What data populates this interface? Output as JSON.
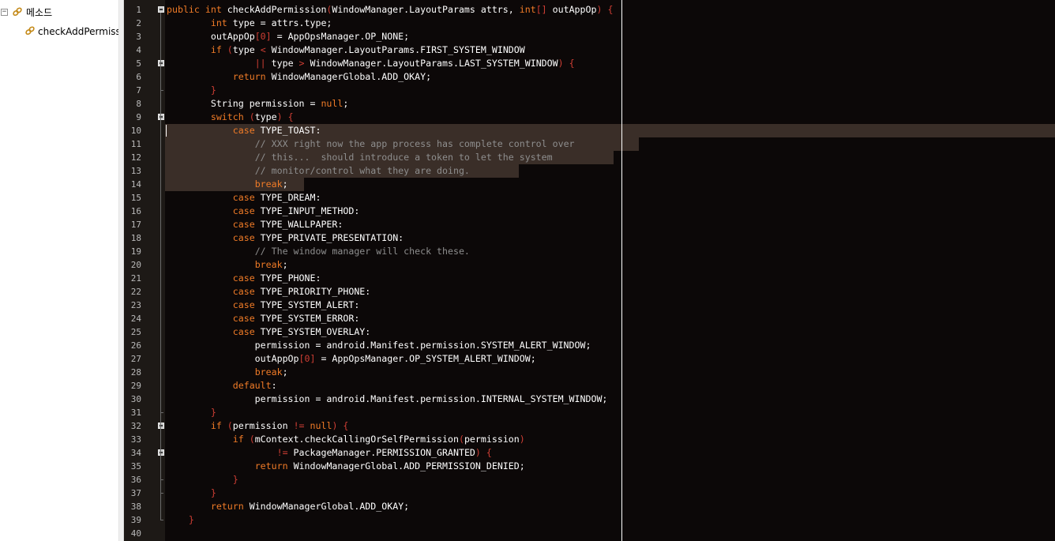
{
  "tree": {
    "root_label": "메소드",
    "root_toggle": "−",
    "child_label": "checkAddPermissic"
  },
  "editor": {
    "caret_line": 10,
    "selection_lines": [
      10,
      11,
      12,
      13,
      14
    ],
    "colors": {
      "background": "#0c0808",
      "keyword": "#f07b27",
      "comment": "#8e8e8e",
      "punctuation": "#cf3e34",
      "text": "#ffffff",
      "selection": "#3a2e28"
    },
    "lines": [
      {
        "n": "1",
        "t": [
          [
            "k",
            "public int "
          ],
          [
            "pl",
            "checkAddPermission"
          ],
          [
            "pn",
            "("
          ],
          [
            "pl",
            "WindowManager.LayoutParams attrs, "
          ],
          [
            "k",
            "int"
          ],
          [
            "pn",
            "[] "
          ],
          [
            "pl",
            "outAppOp"
          ],
          [
            "pn",
            ") {"
          ]
        ]
      },
      {
        "n": "2",
        "t": [
          [
            "pl",
            "        "
          ],
          [
            "k",
            "int "
          ],
          [
            "pl",
            "type = attrs.type;"
          ]
        ]
      },
      {
        "n": "3",
        "t": [
          [
            "pl",
            "        outAppOp"
          ],
          [
            "pn",
            "[0]"
          ],
          [
            "pl",
            " = AppOpsManager.OP_NONE;"
          ]
        ]
      },
      {
        "n": "4",
        "t": [
          [
            "pl",
            "        "
          ],
          [
            "k",
            "if "
          ],
          [
            "pn",
            "("
          ],
          [
            "pl",
            "type "
          ],
          [
            "pn",
            "<"
          ],
          [
            "pl",
            " WindowManager.LayoutParams.FIRST_SYSTEM_WINDOW"
          ]
        ]
      },
      {
        "n": "5",
        "t": [
          [
            "pl",
            "                "
          ],
          [
            "pn",
            "||"
          ],
          [
            "pl",
            " type "
          ],
          [
            "pn",
            ">"
          ],
          [
            "pl",
            " WindowManager.LayoutParams.LAST_SYSTEM_WINDOW"
          ],
          [
            "pn",
            ") {"
          ]
        ]
      },
      {
        "n": "6",
        "t": [
          [
            "pl",
            "            "
          ],
          [
            "k",
            "return "
          ],
          [
            "pl",
            "WindowManagerGlobal.ADD_OKAY;"
          ]
        ]
      },
      {
        "n": "7",
        "t": [
          [
            "pl",
            "        "
          ],
          [
            "pn",
            "}"
          ]
        ]
      },
      {
        "n": "8",
        "t": [
          [
            "pl",
            "        String permission = "
          ],
          [
            "k",
            "null"
          ],
          [
            "pl",
            ";"
          ]
        ]
      },
      {
        "n": "9",
        "t": [
          [
            "pl",
            "        "
          ],
          [
            "k",
            "switch "
          ],
          [
            "pn",
            "("
          ],
          [
            "pl",
            "type"
          ],
          [
            "pn",
            ") {"
          ]
        ]
      },
      {
        "n": "10",
        "t": [
          [
            "pl",
            "            "
          ],
          [
            "k",
            "case "
          ],
          [
            "pl",
            "TYPE_TOAST:"
          ]
        ]
      },
      {
        "n": "11",
        "t": [
          [
            "pl",
            "                "
          ],
          [
            "cm",
            "// XXX right now the app process has complete control over"
          ]
        ]
      },
      {
        "n": "12",
        "t": [
          [
            "pl",
            "                "
          ],
          [
            "cm",
            "// this...  should introduce a token to let the system"
          ]
        ]
      },
      {
        "n": "13",
        "t": [
          [
            "pl",
            "                "
          ],
          [
            "cm",
            "// monitor/control what they are doing."
          ]
        ]
      },
      {
        "n": "14",
        "t": [
          [
            "pl",
            "                "
          ],
          [
            "k",
            "break"
          ],
          [
            "pl",
            ";"
          ]
        ]
      },
      {
        "n": "15",
        "t": [
          [
            "pl",
            "            "
          ],
          [
            "k",
            "case "
          ],
          [
            "pl",
            "TYPE_DREAM:"
          ]
        ]
      },
      {
        "n": "16",
        "t": [
          [
            "pl",
            "            "
          ],
          [
            "k",
            "case "
          ],
          [
            "pl",
            "TYPE_INPUT_METHOD:"
          ]
        ]
      },
      {
        "n": "17",
        "t": [
          [
            "pl",
            "            "
          ],
          [
            "k",
            "case "
          ],
          [
            "pl",
            "TYPE_WALLPAPER:"
          ]
        ]
      },
      {
        "n": "18",
        "t": [
          [
            "pl",
            "            "
          ],
          [
            "k",
            "case "
          ],
          [
            "pl",
            "TYPE_PRIVATE_PRESENTATION:"
          ]
        ]
      },
      {
        "n": "19",
        "t": [
          [
            "pl",
            "                "
          ],
          [
            "cm",
            "// The window manager will check these."
          ]
        ]
      },
      {
        "n": "20",
        "t": [
          [
            "pl",
            "                "
          ],
          [
            "k",
            "break"
          ],
          [
            "pl",
            ";"
          ]
        ]
      },
      {
        "n": "21",
        "t": [
          [
            "pl",
            "            "
          ],
          [
            "k",
            "case "
          ],
          [
            "pl",
            "TYPE_PHONE:"
          ]
        ]
      },
      {
        "n": "22",
        "t": [
          [
            "pl",
            "            "
          ],
          [
            "k",
            "case "
          ],
          [
            "pl",
            "TYPE_PRIORITY_PHONE:"
          ]
        ]
      },
      {
        "n": "23",
        "t": [
          [
            "pl",
            "            "
          ],
          [
            "k",
            "case "
          ],
          [
            "pl",
            "TYPE_SYSTEM_ALERT:"
          ]
        ]
      },
      {
        "n": "24",
        "t": [
          [
            "pl",
            "            "
          ],
          [
            "k",
            "case "
          ],
          [
            "pl",
            "TYPE_SYSTEM_ERROR:"
          ]
        ]
      },
      {
        "n": "25",
        "t": [
          [
            "pl",
            "            "
          ],
          [
            "k",
            "case "
          ],
          [
            "pl",
            "TYPE_SYSTEM_OVERLAY:"
          ]
        ]
      },
      {
        "n": "26",
        "t": [
          [
            "pl",
            "                permission = android.Manifest.permission.SYSTEM_ALERT_WINDOW;"
          ]
        ]
      },
      {
        "n": "27",
        "t": [
          [
            "pl",
            "                outAppOp"
          ],
          [
            "pn",
            "[0]"
          ],
          [
            "pl",
            " = AppOpsManager.OP_SYSTEM_ALERT_WINDOW;"
          ]
        ]
      },
      {
        "n": "28",
        "t": [
          [
            "pl",
            "                "
          ],
          [
            "k",
            "break"
          ],
          [
            "pl",
            ";"
          ]
        ]
      },
      {
        "n": "29",
        "t": [
          [
            "pl",
            "            "
          ],
          [
            "k",
            "default"
          ],
          [
            "pl",
            ":"
          ]
        ]
      },
      {
        "n": "30",
        "t": [
          [
            "pl",
            "                permission = android.Manifest.permission.INTERNAL_SYSTEM_WINDOW;"
          ]
        ]
      },
      {
        "n": "31",
        "t": [
          [
            "pl",
            "        "
          ],
          [
            "pn",
            "}"
          ]
        ]
      },
      {
        "n": "32",
        "t": [
          [
            "pl",
            "        "
          ],
          [
            "k",
            "if "
          ],
          [
            "pn",
            "("
          ],
          [
            "pl",
            "permission "
          ],
          [
            "pn",
            "!="
          ],
          [
            "pl",
            " "
          ],
          [
            "k",
            "null"
          ],
          [
            "pn",
            ") {"
          ]
        ]
      },
      {
        "n": "33",
        "t": [
          [
            "pl",
            "            "
          ],
          [
            "k",
            "if "
          ],
          [
            "pn",
            "("
          ],
          [
            "pl",
            "mContext.checkCallingOrSelfPermission"
          ],
          [
            "pn",
            "("
          ],
          [
            "pl",
            "permission"
          ],
          [
            "pn",
            ")"
          ]
        ]
      },
      {
        "n": "34",
        "t": [
          [
            "pl",
            "                    "
          ],
          [
            "pn",
            "!="
          ],
          [
            "pl",
            " PackageManager.PERMISSION_GRANTED"
          ],
          [
            "pn",
            ") {"
          ]
        ]
      },
      {
        "n": "35",
        "t": [
          [
            "pl",
            "                "
          ],
          [
            "k",
            "return "
          ],
          [
            "pl",
            "WindowManagerGlobal.ADD_PERMISSION_DENIED;"
          ]
        ]
      },
      {
        "n": "36",
        "t": [
          [
            "pl",
            "            "
          ],
          [
            "pn",
            "}"
          ]
        ]
      },
      {
        "n": "37",
        "t": [
          [
            "pl",
            "        "
          ],
          [
            "pn",
            "}"
          ]
        ]
      },
      {
        "n": "38",
        "t": [
          [
            "pl",
            "        "
          ],
          [
            "k",
            "return "
          ],
          [
            "pl",
            "WindowManagerGlobal.ADD_OKAY;"
          ]
        ]
      },
      {
        "n": "39",
        "t": [
          [
            "pl",
            "    "
          ],
          [
            "pn",
            "}"
          ]
        ]
      },
      {
        "n": "40",
        "t": []
      }
    ]
  }
}
